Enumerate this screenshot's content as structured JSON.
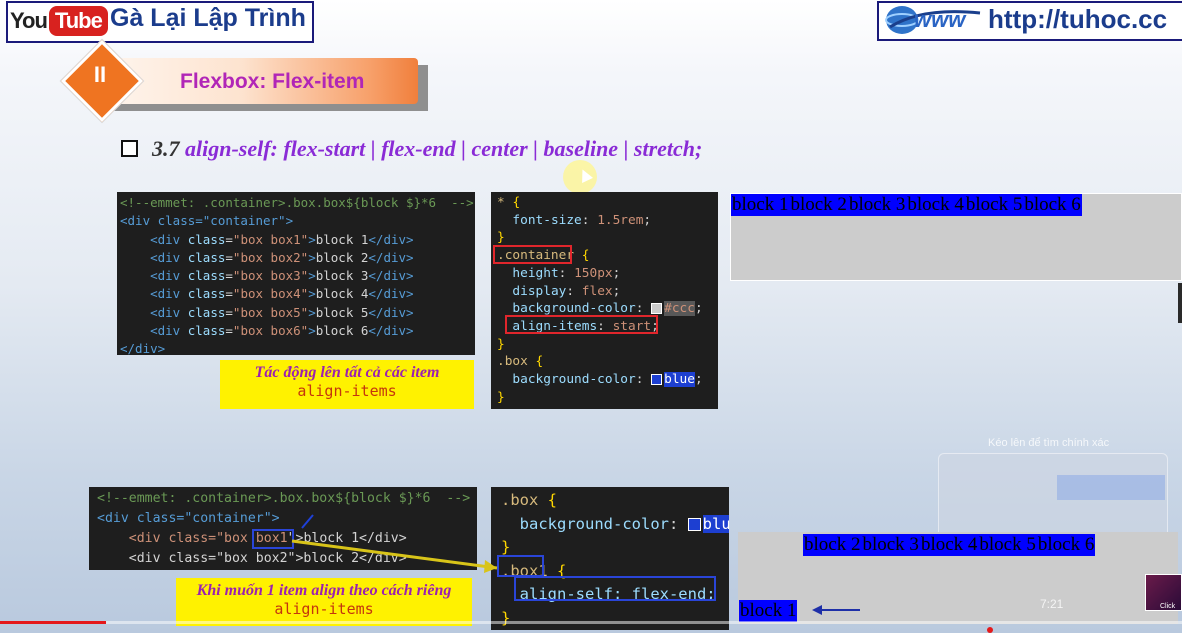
{
  "header": {
    "youtube_you": "You",
    "youtube_tube": "Tube",
    "channel_name": "Gà Lại Lập Trình",
    "website": "http://tuhoc.cc",
    "www_text": "www"
  },
  "section": {
    "number": "II",
    "title": "Flexbox: Flex-item"
  },
  "heading": {
    "number": "3.7",
    "text": "align-self:  flex-start | flex-end | center | baseline | stretch;"
  },
  "code_html_1": {
    "line0": "<!--emmet: .container>.box.box${block $}*6  -->",
    "open_tag": "<div class=\"container\">",
    "rows": [
      {
        "cls": "\"box box1\"",
        "text": "block 1"
      },
      {
        "cls": "\"box box2\"",
        "text": "block 2"
      },
      {
        "cls": "\"box box3\"",
        "text": "block 3"
      },
      {
        "cls": "\"box box4\"",
        "text": "block 4"
      },
      {
        "cls": "\"box box5\"",
        "text": "block 5"
      },
      {
        "cls": "\"box box6\"",
        "text": "block 6"
      }
    ],
    "close_tag": "</div>"
  },
  "code_css_1": {
    "star": "*",
    "font_size_prop": "font-size",
    "font_size_val": "1.5rem",
    "container_sel": ".container",
    "height_prop": "height",
    "height_val": "150px",
    "display_prop": "display",
    "display_val": "flex",
    "bg_prop": "background-color",
    "bg_val": "#ccc",
    "align_prop": "align-items",
    "align_val": "start",
    "box_sel": ".box",
    "box_bg_prop": "background-color",
    "box_bg_val": "blue"
  },
  "note_1": {
    "line1": "Tác động lên tất cả các item",
    "line2": "align-items"
  },
  "demo_1": {
    "blocks": [
      "block 1",
      "block 2",
      "block 3",
      "block 4",
      "block 5",
      "block 6"
    ],
    "align_items": "start",
    "container_color": "#cccccc",
    "block_color": "#0000ff"
  },
  "code_html_2": {
    "line0": "<!--emmet: .container>.box.box${block $}*6  -->",
    "open_tag": "<div class=\"container\">",
    "row1_pre": "<div class=\"box ",
    "row1_cls": "box1",
    "row1_post": "\">block 1</div>",
    "row2": "<div class=\"box box2\">block 2</div>"
  },
  "code_css_2": {
    "box_sel": ".box",
    "bg_prop": "background-color",
    "bg_val": "blu",
    "box1_sel": ".box1",
    "align_self": "align-self: flex-end;"
  },
  "note_2": {
    "line1": "Khi muốn 1 item align theo cách riêng",
    "line2": "align-items"
  },
  "demo_2": {
    "top_blocks": [
      "block 2",
      "block 3",
      "block 4",
      "block 5",
      "block 6"
    ],
    "bottom_block": "block 1"
  },
  "overlay": {
    "caption": "Kéo lên để tìm chính xác",
    "time": "7:21",
    "avatar_label": "Click"
  },
  "video": {
    "progress": 0.09
  }
}
